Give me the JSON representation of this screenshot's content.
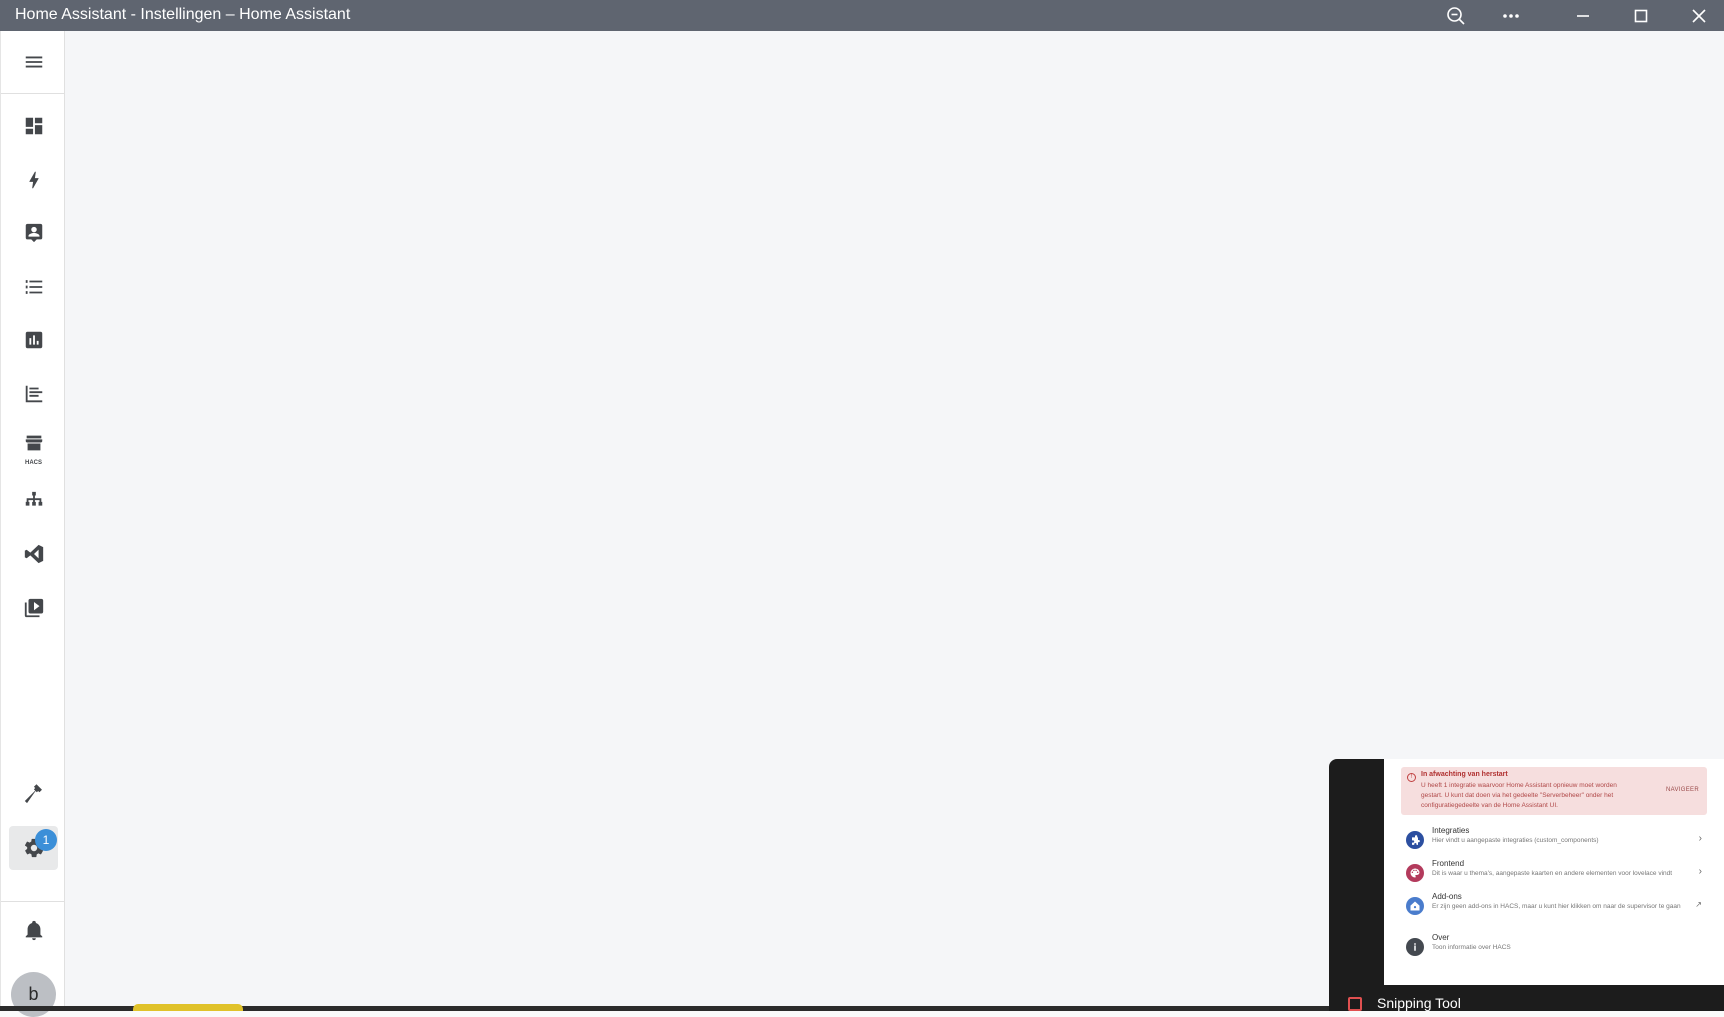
{
  "window": {
    "title": "Home Assistant - Instellingen – Home Assistant"
  },
  "sidebar": {
    "items": [
      {
        "name": "menu-icon"
      },
      {
        "name": "overview-icon"
      },
      {
        "name": "energy-icon"
      },
      {
        "name": "map-icon"
      },
      {
        "name": "logbook-icon"
      },
      {
        "name": "history-icon"
      },
      {
        "name": "history-graph-icon"
      },
      {
        "name": "hacs-icon",
        "label": "HACS"
      },
      {
        "name": "network-icon"
      },
      {
        "name": "vscode-icon"
      },
      {
        "name": "media-icon"
      },
      {
        "name": "developer-tools-icon"
      },
      {
        "name": "settings-icon",
        "badge": "1"
      },
      {
        "name": "notifications-icon"
      }
    ],
    "avatar_letter": "b"
  },
  "snipping_tool": {
    "app_name": "Snipping Tool",
    "alert": {
      "title": "In afwachting van herstart",
      "body": "U heeft 1 integratie waarvoor Home Assistant opnieuw moet worden gestart. U kunt dat doen via het gedeelte \"Serverbeheer\" onder het configuratiegedeelte van de Home Assistant UI.",
      "action": "NAVIGEER"
    },
    "rows": [
      {
        "title": "Integraties",
        "subtitle": "Hier vindt u aangepaste integraties (custom_components)",
        "color": "#2c4fa0"
      },
      {
        "title": "Frontend",
        "subtitle": "Dit is waar u thema's, aangepaste kaarten en andere elementen voor lovelace vindt",
        "color": "#b33a5c"
      },
      {
        "title": "Add-ons",
        "subtitle": "Er zijn geen add-ons in HACS, maar u kunt hier klikken om naar de supervisor te gaan",
        "color": "#4a7ccc"
      },
      {
        "title": "Over",
        "subtitle": "Toon informatie over HACS",
        "color": "#444950"
      }
    ]
  }
}
